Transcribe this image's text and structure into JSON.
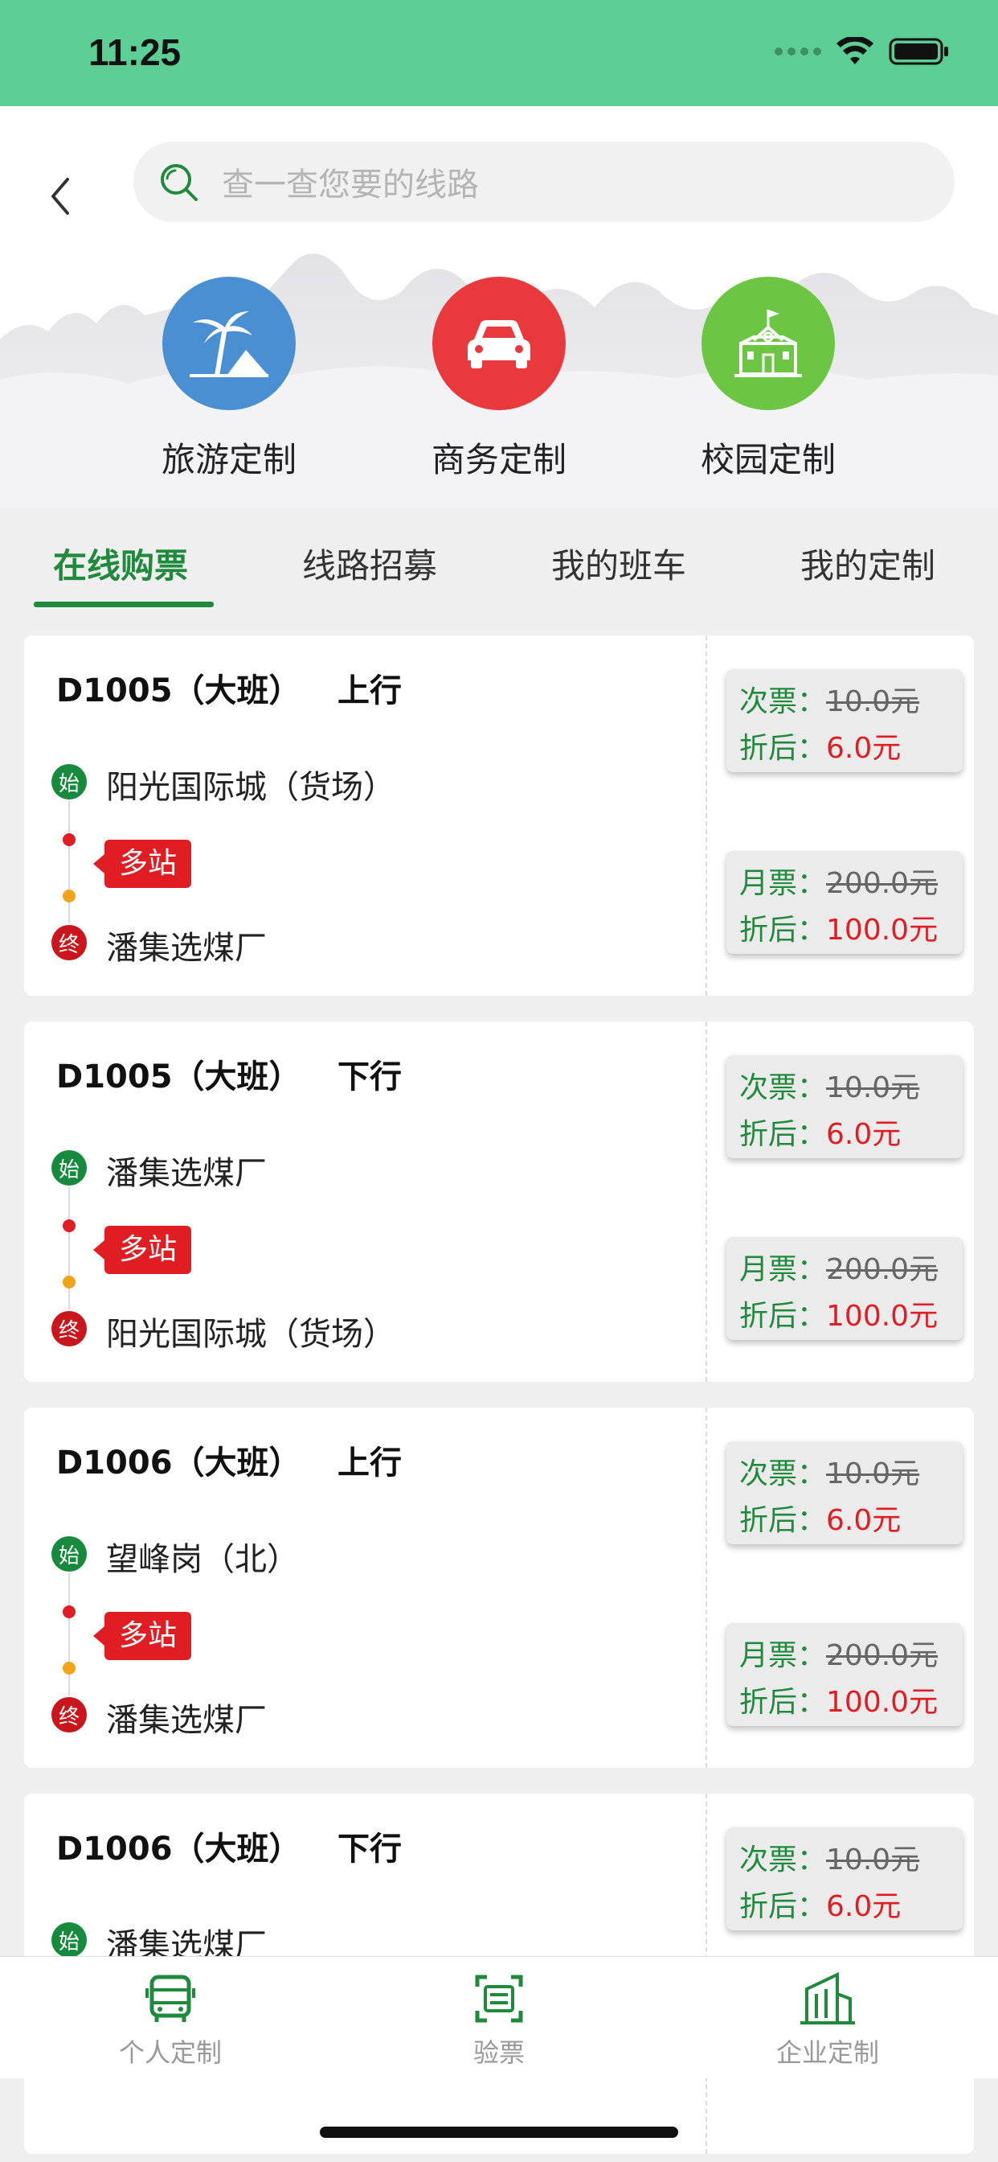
{
  "status_bar": {
    "time": "11:25"
  },
  "search": {
    "placeholder": "查一查您要的线路"
  },
  "categories": [
    {
      "label": "旅游定制",
      "color": "#4a8fd2",
      "icon": "palm-tree-icon"
    },
    {
      "label": "商务定制",
      "color": "#e83a3c",
      "icon": "car-icon"
    },
    {
      "label": "校园定制",
      "color": "#6cc644",
      "icon": "school-icon"
    }
  ],
  "tabs": [
    {
      "label": "在线购票",
      "active": true
    },
    {
      "label": "线路招募",
      "active": false
    },
    {
      "label": "我的班车",
      "active": false
    },
    {
      "label": "我的定制",
      "active": false
    }
  ],
  "routes": [
    {
      "code": "D1005（大班）",
      "direction": "上行",
      "start_badge": "始",
      "start": "阳光国际城（货场）",
      "multi": "多站",
      "end_badge": "终",
      "end": "潘集选煤厂",
      "single_label": "次票：",
      "single_orig": "10.0元",
      "disc_label": "折后：",
      "single_disc": "6.0元",
      "month_label": "月票：",
      "month_orig": "200.0元",
      "month_disc_label": "折后：",
      "month_disc": "100.0元"
    },
    {
      "code": "D1005（大班）",
      "direction": "下行",
      "start_badge": "始",
      "start": "潘集选煤厂",
      "multi": "多站",
      "end_badge": "终",
      "end": "阳光国际城（货场）",
      "single_label": "次票：",
      "single_orig": "10.0元",
      "disc_label": "折后：",
      "single_disc": "6.0元",
      "month_label": "月票：",
      "month_orig": "200.0元",
      "month_disc_label": "折后：",
      "month_disc": "100.0元"
    },
    {
      "code": "D1006（大班）",
      "direction": "上行",
      "start_badge": "始",
      "start": "望峰岗（北）",
      "multi": "多站",
      "end_badge": "终",
      "end": "潘集选煤厂",
      "single_label": "次票：",
      "single_orig": "10.0元",
      "disc_label": "折后：",
      "single_disc": "6.0元",
      "month_label": "月票：",
      "month_orig": "200.0元",
      "month_disc_label": "折后：",
      "month_disc": "100.0元"
    },
    {
      "code": "D1006（大班）",
      "direction": "下行",
      "start_badge": "始",
      "start": "潘集选煤厂",
      "single_label": "次票：",
      "single_orig": "10.0元",
      "disc_label": "折后：",
      "single_disc": "6.0元"
    }
  ],
  "bottom_nav": [
    {
      "label": "个人定制",
      "icon": "bus-icon"
    },
    {
      "label": "验票",
      "icon": "ticket-scan-icon"
    },
    {
      "label": "企业定制",
      "icon": "building-icon"
    }
  ],
  "colors": {
    "brand_green": "#1f8a3c",
    "status_bar": "#5ccd95",
    "price_red": "#e11d24"
  }
}
